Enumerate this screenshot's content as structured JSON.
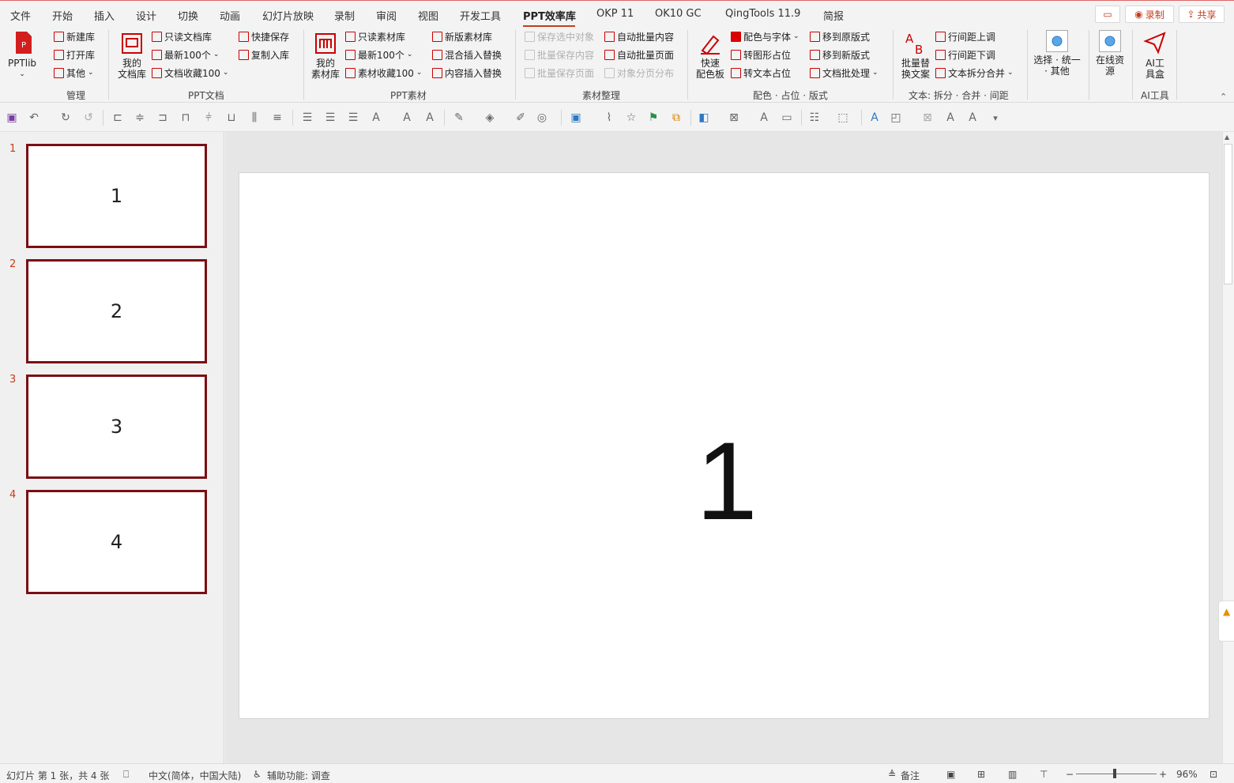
{
  "menu": {
    "tabs": [
      "文件",
      "开始",
      "插入",
      "设计",
      "切换",
      "动画",
      "幻灯片放映",
      "录制",
      "审阅",
      "视图",
      "开发工具",
      "PPT效率库",
      "OKP 11",
      "OK10 GC",
      "QingTools 11.9",
      "简报"
    ],
    "record": "录制",
    "share": "共享"
  },
  "ribbon": {
    "pptlib": "PPTlib",
    "mgmt": {
      "new": "新建库",
      "open": "打开库",
      "other": "其他",
      "label": "管理"
    },
    "doc": {
      "my_a": "我的",
      "my_b": "文档库",
      "readonly": "只读文档库",
      "latest": "最新100个",
      "fav": "文档收藏100",
      "quicksave": "快捷保存",
      "copyin": "复制入库",
      "label": "PPT文档"
    },
    "mat": {
      "my_a": "我的",
      "my_b": "素材库",
      "readonly": "只读素材库",
      "latest": "最新100个",
      "fav": "素材收藏100",
      "newlib": "新版素材库",
      "mixed": "混合插入替换",
      "content": "内容插入替换",
      "label": "PPT素材"
    },
    "org": {
      "save_sel": "保存选中对象",
      "batch_save": "批量保存内容",
      "batch_page": "批量保存页面",
      "auto_content": "自动批量内容",
      "auto_page": "自动批量页面",
      "split": "对象分页分布",
      "label": "素材整理"
    },
    "color": {
      "quick_a": "快速",
      "quick_b": "配色板",
      "color_font": "配色与字体",
      "to_shape": "转图形占位",
      "to_text": "转文本占位",
      "move_orig": "移到原版式",
      "move_new": "移到新版式",
      "batch": "文档批处理",
      "label": "配色 · 占位 · 版式"
    },
    "text": {
      "batch_a": "批量替",
      "batch_b": "换文案",
      "spacing_up": "行间距上调",
      "spacing_down": "行间距下调",
      "split_merge": "文本拆分合并",
      "label": "文本: 拆分 · 合并 · 间距"
    },
    "select": {
      "a": "选择 · 统一",
      "b": "· 其他"
    },
    "online": {
      "a": "在线资",
      "b": "源"
    },
    "ai": {
      "a": "AI工",
      "b": "具盒",
      "label": "AI工具"
    }
  },
  "slides": [
    {
      "num": "1",
      "text": "1"
    },
    {
      "num": "2",
      "text": "2"
    },
    {
      "num": "3",
      "text": "3"
    },
    {
      "num": "4",
      "text": "4"
    }
  ],
  "current_slide": {
    "text": "1"
  },
  "status": {
    "slide_info": "幻灯片 第 1 张，共 4 张",
    "language": "中文(简体，中国大陆)",
    "accessibility": "辅助功能: 调查",
    "notes": "备注",
    "zoom": "96%"
  }
}
